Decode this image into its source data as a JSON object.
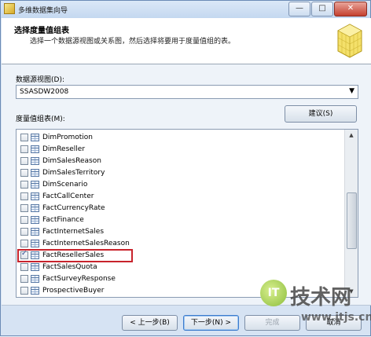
{
  "window": {
    "title": "多维数据集向导",
    "minimize": "—",
    "maximize": "□",
    "close": "✕"
  },
  "header": {
    "title": "选择度量值组表",
    "subtitle": "选择一个数据源视图或关系图，然后选择将要用于度量值组的表。"
  },
  "dsv": {
    "label": "数据源视图(D):",
    "value": "SSASDW2008"
  },
  "measure_groups": {
    "label": "度量值组表(M):",
    "suggest_label": "建议(S)",
    "items": [
      {
        "label": "DimPromotion",
        "checked": false
      },
      {
        "label": "DimReseller",
        "checked": false
      },
      {
        "label": "DimSalesReason",
        "checked": false
      },
      {
        "label": "DimSalesTerritory",
        "checked": false
      },
      {
        "label": "DimScenario",
        "checked": false
      },
      {
        "label": "FactCallCenter",
        "checked": false
      },
      {
        "label": "FactCurrencyRate",
        "checked": false
      },
      {
        "label": "FactFinance",
        "checked": false
      },
      {
        "label": "FactInternetSales",
        "checked": false
      },
      {
        "label": "FactInternetSalesReason",
        "checked": false
      },
      {
        "label": "FactResellerSales",
        "checked": true
      },
      {
        "label": "FactSalesQuota",
        "checked": false
      },
      {
        "label": "FactSurveyResponse",
        "checked": false
      },
      {
        "label": "ProspectiveBuyer",
        "checked": false
      }
    ]
  },
  "footer": {
    "back_label": "< 上一步(B)",
    "next_label": "下一步(N) >",
    "finish_label": "完成",
    "cancel_label": "取消"
  },
  "watermark": {
    "logo": "IT",
    "text": "技术网",
    "url": "www.itjs.cn"
  }
}
